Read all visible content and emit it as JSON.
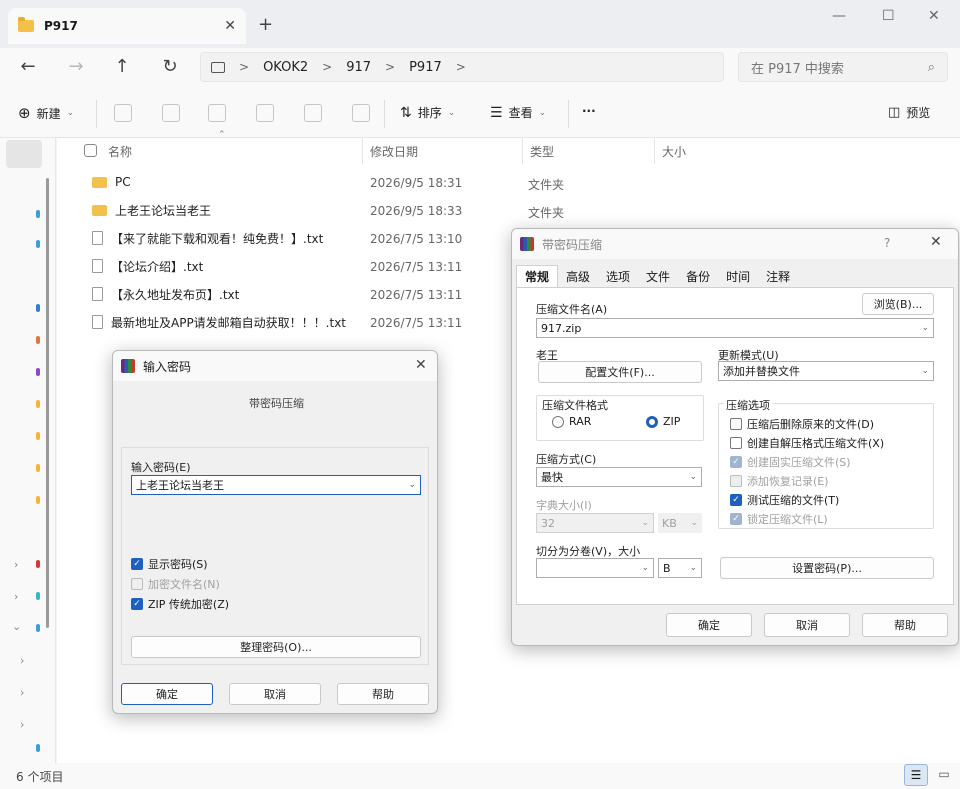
{
  "window": {
    "tab_title": "P917",
    "new_tab": "+",
    "minimize": "—",
    "maximize": "☐",
    "close": "✕"
  },
  "nav": {
    "back": "←",
    "forward": "→",
    "up": "↑",
    "refresh": "↻",
    "breadcrumb": [
      "OKOK2",
      "917",
      "P917"
    ],
    "sep": ">",
    "search_placeholder": "在 P917 中搜索"
  },
  "toolbar": {
    "new_label": "新建",
    "sort_label": "排序",
    "view_label": "查看",
    "more": "···",
    "preview_label": "预览"
  },
  "columns": {
    "name": "名称",
    "modified": "修改日期",
    "type": "类型",
    "size": "大小"
  },
  "files": [
    {
      "name": "PC",
      "date": "2026/9/5 18:31",
      "type": "文件夹",
      "kind": "folder"
    },
    {
      "name": "上老王论坛当老王",
      "date": "2026/9/5 18:33",
      "type": "文件夹",
      "kind": "folder"
    },
    {
      "name": "【来了就能下载和观看！纯免费！】.txt",
      "date": "2026/7/5 13:10",
      "type": "",
      "kind": "txt"
    },
    {
      "name": "【论坛介绍】.txt",
      "date": "2026/7/5 13:11",
      "type": "",
      "kind": "txt"
    },
    {
      "name": "【永久地址发布页】.txt",
      "date": "2026/7/5 13:11",
      "type": "",
      "kind": "txt"
    },
    {
      "name": "最新地址及APP请发邮箱自动获取！！！.txt",
      "date": "2026/7/5 13:11",
      "type": "",
      "kind": "txt"
    }
  ],
  "status": {
    "count": "6 个项目"
  },
  "password_dialog": {
    "title": "输入密码",
    "subtitle": "带密码压缩",
    "field_label": "输入密码(E)",
    "field_value": "上老王论坛当老王",
    "show_password": "显示密码(S)",
    "encrypt_names": "加密文件名(N)",
    "zip_legacy": "ZIP 传统加密(Z)",
    "organize": "整理密码(O)...",
    "ok": "确定",
    "cancel": "取消",
    "help": "帮助"
  },
  "archive_dialog": {
    "title": "带密码压缩",
    "help_q": "?",
    "tabs": [
      "常规",
      "高级",
      "选项",
      "文件",
      "备份",
      "时间",
      "注释"
    ],
    "archive_name_label": "压缩文件名(A)",
    "browse": "浏览(B)...",
    "archive_name": "917.zip",
    "profile_label": "老王",
    "profiles_button": "配置文件(F)...",
    "update_label": "更新模式(U)",
    "update_value": "添加并替换文件",
    "format_label": "压缩文件格式",
    "format_rar": "RAR",
    "format_zip": "ZIP",
    "method_label": "压缩方式(C)",
    "method_value": "最快",
    "dict_label": "字典大小(I)",
    "dict_value": "32",
    "dict_unit": "KB",
    "split_label": "切分为分卷(V)，大小",
    "split_unit": "B",
    "options_label": "压缩选项",
    "opt1": "压缩后删除原来的文件(D)",
    "opt2": "创建自解压格式压缩文件(X)",
    "opt3": "创建固实压缩文件(S)",
    "opt4": "添加恢复记录(E)",
    "opt5": "测试压缩的文件(T)",
    "opt6": "锁定压缩文件(L)",
    "set_password": "设置密码(P)...",
    "ok": "确定",
    "cancel": "取消",
    "help": "帮助"
  }
}
